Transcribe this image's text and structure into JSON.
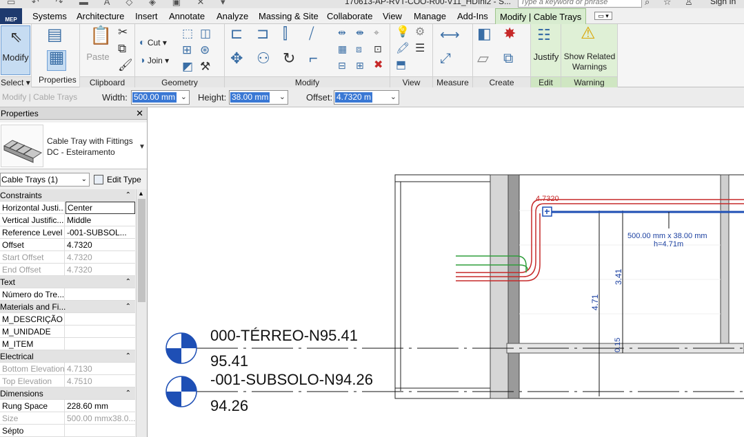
{
  "titlebar": {
    "file_title": "170613-AP-RVT-COO-R00-V11_HDIni2 - S...",
    "search_placeholder": "Type a keyword or phrase",
    "sign_in": "Sign In"
  },
  "app_button": "MEP",
  "tabs": [
    {
      "label": "Systems"
    },
    {
      "label": "Architecture"
    },
    {
      "label": "Insert"
    },
    {
      "label": "Annotate"
    },
    {
      "label": "Analyze"
    },
    {
      "label": "Massing & Site"
    },
    {
      "label": "Collaborate"
    },
    {
      "label": "View"
    },
    {
      "label": "Manage"
    },
    {
      "label": "Add-Ins"
    },
    {
      "label": "Modify | Cable Trays"
    }
  ],
  "ribbon": {
    "select": {
      "button": "Modify",
      "label": "Select"
    },
    "properties": {
      "button": "Properties",
      "label": "Properties"
    },
    "clipboard": {
      "button": "Paste",
      "label": "Clipboard"
    },
    "geometry": {
      "cut": "Cut",
      "join": "Join",
      "label": "Geometry"
    },
    "modify": {
      "label": "Modify"
    },
    "view": {
      "label": "View"
    },
    "measure": {
      "label": "Measure"
    },
    "create": {
      "label": "Create"
    },
    "edit": {
      "button": "Justify",
      "label": "Edit"
    },
    "warning": {
      "button_line1": "Show Related",
      "button_line2": "Warnings",
      "label": "Warning"
    }
  },
  "options_bar": {
    "context": "Modify | Cable Trays",
    "width_label": "Width:",
    "width_value": "500.00 mm",
    "height_label": "Height:",
    "height_value": "38.00 mm",
    "offset_label": "Offset:",
    "offset_value": "4.7320 m"
  },
  "properties": {
    "title": "Properties",
    "type_line1": "Cable Tray with Fittings",
    "type_line2": "DC - Esteiramento",
    "instance_filter": "Cable Trays (1)",
    "edit_type": "Edit Type",
    "groups": {
      "constraints": "Constraints",
      "text": "Text",
      "materials": "Materials and Fi...",
      "electrical": "Electrical",
      "dimensions": "Dimensions"
    },
    "rows": {
      "horizontal_justification": {
        "key": "Horizontal Justi...",
        "value": "Center"
      },
      "vertical_justification": {
        "key": "Vertical Justific...",
        "value": "Middle"
      },
      "reference_level": {
        "key": "Reference Level",
        "value": "-001-SUBSOL..."
      },
      "offset": {
        "key": "Offset",
        "value": "4.7320"
      },
      "start_offset": {
        "key": "Start Offset",
        "value": "4.7320"
      },
      "end_offset": {
        "key": "End Offset",
        "value": "4.7320"
      },
      "numero_tre": {
        "key": "Número do Tre...",
        "value": ""
      },
      "m_descricao": {
        "key": "M_DESCRIÇÃO",
        "value": ""
      },
      "m_unidade": {
        "key": "M_UNIDADE",
        "value": ""
      },
      "m_item": {
        "key": "M_ITEM",
        "value": ""
      },
      "bottom_elevation": {
        "key": "Bottom Elevation",
        "value": "4.7130"
      },
      "top_elevation": {
        "key": "Top Elevation",
        "value": "4.7510"
      },
      "rung_space": {
        "key": "Rung Space",
        "value": "228.60 mm"
      },
      "size": {
        "key": "Size",
        "value": "500.00 mmx38.0..."
      },
      "septo": {
        "key": "Sépto",
        "value": ""
      }
    }
  },
  "drawing": {
    "level_terreo_name": "000-TÉRREO-N95.41",
    "level_terreo_elev": "95.41",
    "level_subsolo_name": "-001-SUBSOLO-N94.26",
    "level_subsolo_elev": "94.26",
    "tray_tag_line1": "500.00 mm x 38.00 mm",
    "tray_tag_line2": "h=4.71m",
    "offset_tag": "4.7320",
    "dim_471": "4.71",
    "dim_341": "3.41",
    "dim_015": "0.15"
  },
  "colors": {
    "mep_blue": "#1e3a6e",
    "active_tab": "#d8ecd0",
    "selection_blue": "#3a78d4",
    "annotation_blue": "#1a3fa0",
    "conduit_red": "#c62828",
    "conduit_green": "#2e9d3a"
  }
}
